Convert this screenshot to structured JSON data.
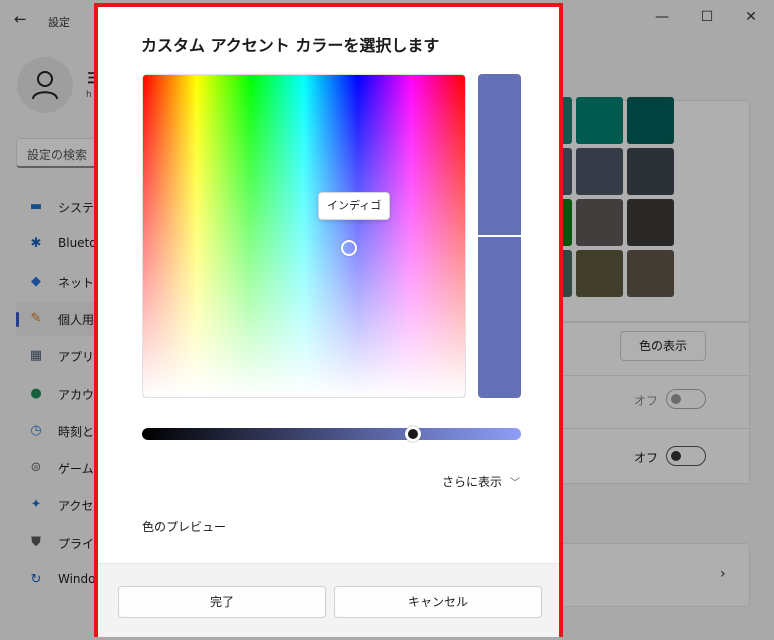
{
  "window": {
    "title": "設定",
    "back_icon": "←",
    "minimize_icon": "—",
    "maximize_icon": "☐",
    "close_icon": "✕"
  },
  "user": {
    "name": "ヨ",
    "email": "h"
  },
  "search": {
    "placeholder": "設定の検索"
  },
  "sidebar": {
    "items": [
      {
        "label": "システム",
        "icon": "monitor-icon",
        "color": "#1e6fc7"
      },
      {
        "label": "Blueto",
        "icon": "bluetooth-icon",
        "color": "#1b5fb8"
      },
      {
        "label": "ネットワ",
        "icon": "wifi-icon",
        "color": "#2a6fd6"
      },
      {
        "label": "個人用",
        "icon": "brush-icon",
        "color": "#c77a1e",
        "active": true
      },
      {
        "label": "アプリ",
        "icon": "apps-icon",
        "color": "#4a5b74"
      },
      {
        "label": "アカウン",
        "icon": "account-icon",
        "color": "#1f8c5a"
      },
      {
        "label": "時刻と",
        "icon": "clock-icon",
        "color": "#2f7bd6"
      },
      {
        "label": "ゲーム",
        "icon": "gamepad-icon",
        "color": "#6b6b6b"
      },
      {
        "label": "アクセシ",
        "icon": "accessibility-icon",
        "color": "#1e6fc7"
      },
      {
        "label": "プライバ",
        "icon": "shield-icon",
        "color": "#5a5a5a"
      },
      {
        "label": "Windo",
        "icon": "update-icon",
        "color": "#1b5fb8"
      }
    ]
  },
  "background_panel": {
    "swatches": [
      [
        "#1c7c70",
        "#008272",
        "#00605a"
      ],
      [
        "#515c6b",
        "#4c5566",
        "#3f4550"
      ],
      [
        "#107c10",
        "#5d5a58",
        "#3b3a39"
      ],
      [
        "#486860",
        "#5d5a3e",
        "#5f574b"
      ]
    ],
    "show_color_button": "色の表示",
    "toggle1_label": "オフ",
    "toggle2_label": "オフ",
    "chevron_right_icon": "›"
  },
  "dialog": {
    "title": "カスタム アクセント カラーを選択します",
    "tooltip": "インディゴ",
    "selected_color": "#6470b5",
    "value_slider_position": 0.7,
    "more_label": "さらに表示",
    "chevron_down_icon": "﹀",
    "preview_label": "色のプレビュー",
    "done_button": "完了",
    "cancel_button": "キャンセル"
  }
}
